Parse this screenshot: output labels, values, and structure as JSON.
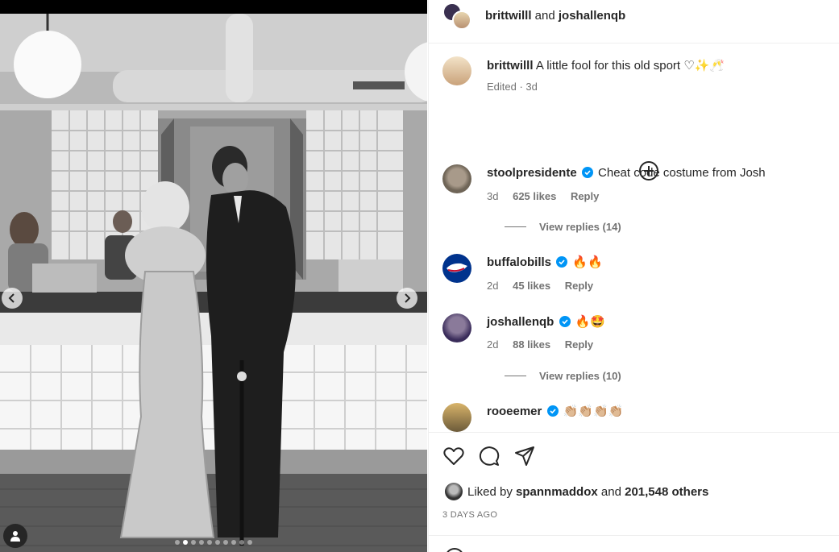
{
  "header": {
    "user1": "brittwilll",
    "joiner": "and",
    "user2": "joshallenqb"
  },
  "caption": {
    "username": "brittwilll",
    "text": "A little fool for this old sport ♡✨🥂",
    "meta": "Edited · 3d"
  },
  "comments": [
    {
      "username": "stoolpresidente",
      "verified": true,
      "text": "Cheat code costume from Josh",
      "age": "3d",
      "likes": "625 likes",
      "reply": "Reply",
      "view_replies": "View replies (14)"
    },
    {
      "username": "buffalobills",
      "verified": true,
      "text": "🔥🔥",
      "age": "2d",
      "likes": "45 likes",
      "reply": "Reply"
    },
    {
      "username": "joshallenqb",
      "verified": true,
      "text": "🔥🤩",
      "age": "2d",
      "likes": "88 likes",
      "reply": "Reply",
      "view_replies": "View replies (10)"
    },
    {
      "username": "rooeemer",
      "verified": true,
      "text": "👏🏼👏🏼👏🏼👏🏼"
    }
  ],
  "likes": {
    "prefix": "Liked by",
    "user": "spannmaddox",
    "joiner": "and",
    "others": "201,548 others"
  },
  "date": "3 DAYS AGO",
  "carousel": {
    "slide_count": 10,
    "active_index": 1
  },
  "colors": {
    "verified": "#0095f6",
    "meta_gray": "#737373",
    "bills_blue": "#00338d",
    "bills_red": "#c60c30"
  }
}
